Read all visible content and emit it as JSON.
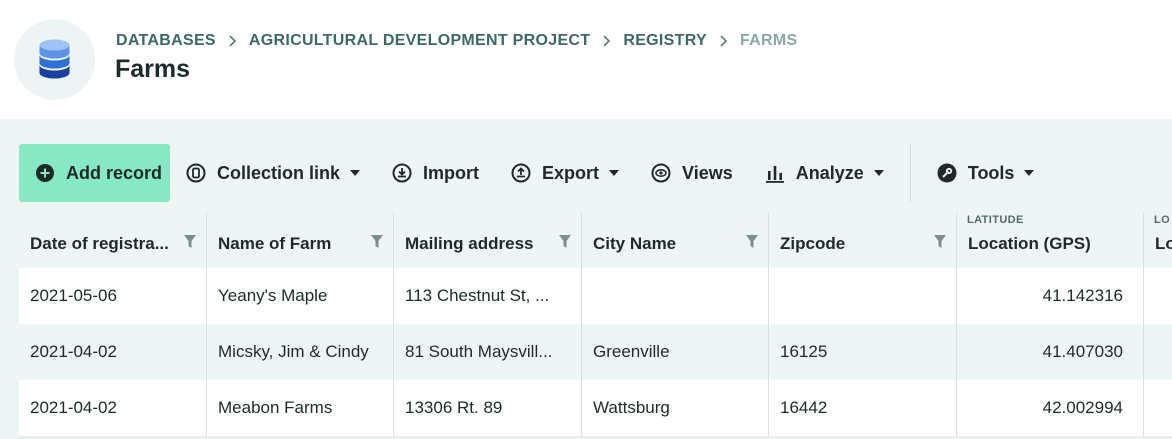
{
  "header": {
    "breadcrumb": [
      "DATABASES",
      "AGRICULTURAL DEVELOPMENT PROJECT",
      "REGISTRY",
      "FARMS"
    ],
    "title": "Farms",
    "icon": "database-icon"
  },
  "toolbar": {
    "add_record": "Add record",
    "collection_link": "Collection link",
    "import": "Import",
    "export": "Export",
    "views": "Views",
    "analyze": "Analyze",
    "tools": "Tools"
  },
  "table": {
    "columns": [
      {
        "label": "Date of registra...",
        "sub": "",
        "filter": true
      },
      {
        "label": "Name of Farm",
        "sub": "",
        "filter": true
      },
      {
        "label": "Mailing address",
        "sub": "",
        "filter": true
      },
      {
        "label": "City Name",
        "sub": "",
        "filter": true
      },
      {
        "label": "Zipcode",
        "sub": "",
        "filter": true
      },
      {
        "label": "Location (GPS)",
        "sub": "LATITUDE",
        "filter": false
      },
      {
        "label": "Lo",
        "sub": "LO",
        "filter": false
      }
    ],
    "rows": [
      [
        "2021-05-06",
        "Yeany's Maple",
        "113 Chestnut St, ...",
        "",
        "",
        "41.142316",
        ""
      ],
      [
        "2021-04-02",
        "Micsky, Jim & Cindy",
        "81 South Maysvill...",
        "Greenville",
        "16125",
        "41.407030",
        ""
      ],
      [
        "2021-04-02",
        "Meabon Farms",
        "13306 Rt. 89",
        "Wattsburg",
        "16442",
        "42.002994",
        ""
      ]
    ]
  },
  "colors": {
    "accent": "#86e8c4",
    "toolbar_bg": "#eff5f5",
    "breadcrumb": "#3c6868",
    "breadcrumb_current": "#8aa8a8",
    "db_icon": "#1f4fbf"
  }
}
